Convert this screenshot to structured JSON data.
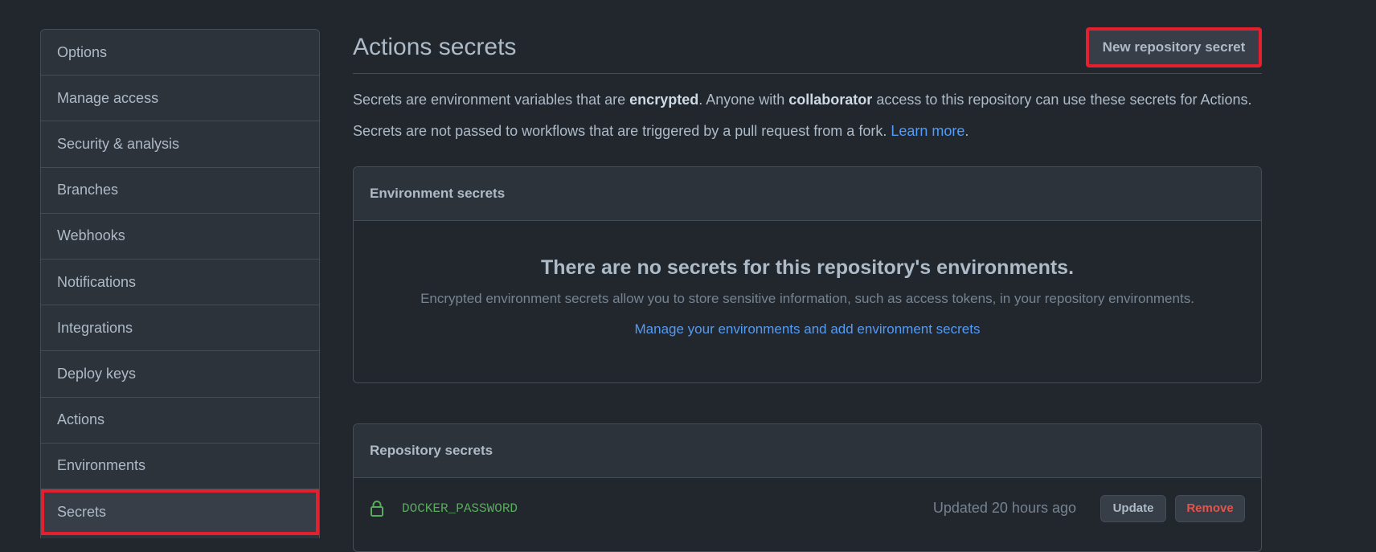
{
  "sidebar": {
    "items": [
      {
        "label": "Options"
      },
      {
        "label": "Manage access"
      },
      {
        "label": "Security & analysis"
      },
      {
        "label": "Branches"
      },
      {
        "label": "Webhooks"
      },
      {
        "label": "Notifications"
      },
      {
        "label": "Integrations"
      },
      {
        "label": "Deploy keys"
      },
      {
        "label": "Actions"
      },
      {
        "label": "Environments"
      },
      {
        "label": "Secrets",
        "selected": true
      }
    ]
  },
  "header": {
    "title": "Actions secrets",
    "new_secret_label": "New repository secret"
  },
  "intro": {
    "p1_a": "Secrets are environment variables that are ",
    "p1_b": "encrypted",
    "p1_c": ". Anyone with ",
    "p1_d": "collaborator",
    "p1_e": " access to this repository can use these secrets for Actions.",
    "p2_a": "Secrets are not passed to workflows that are triggered by a pull request from a fork. ",
    "p2_link": "Learn more",
    "p2_end": "."
  },
  "environment_secrets": {
    "heading": "Environment secrets",
    "blank_title": "There are no secrets for this repository's environments.",
    "blank_desc": "Encrypted environment secrets allow you to store sensitive information, such as access tokens, in your repository environments.",
    "blank_link": "Manage your environments and add environment secrets"
  },
  "repository_secrets": {
    "heading": "Repository secrets",
    "items": [
      {
        "icon": "lock-icon",
        "name": "DOCKER_PASSWORD",
        "updated": "Updated 20 hours ago",
        "update_label": "Update",
        "remove_label": "Remove"
      }
    ]
  },
  "colors": {
    "background": "#22272e",
    "accent_link": "#539bf5",
    "secret_name": "#57ab5a",
    "danger": "#e5534b",
    "highlight_box": "#e5202e"
  }
}
